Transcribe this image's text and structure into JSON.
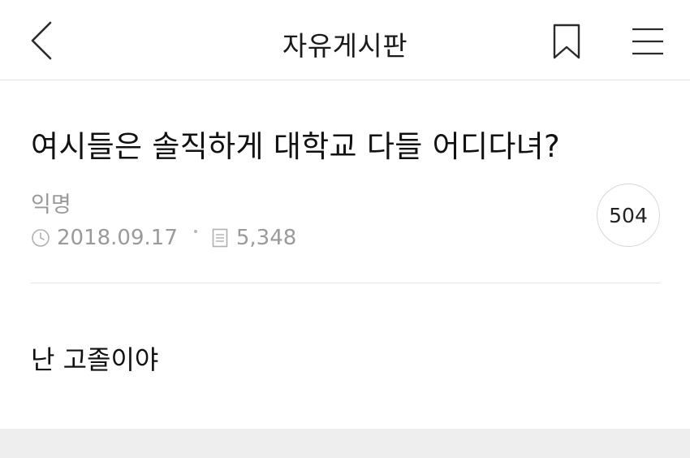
{
  "header": {
    "title": "자유게시판",
    "icons": {
      "back": "chevron-left-icon",
      "bookmark": "bookmark-icon",
      "menu": "hamburger-menu-icon"
    }
  },
  "post": {
    "title": "여시들은 솔직하게 대학교 다들 어디다녀?",
    "author": "익명",
    "date": "2018.09.17",
    "views": "5,348",
    "comments": "504",
    "body": "난 고졸이야"
  },
  "colors": {
    "text": "#111111",
    "meta": "#9a9a9a",
    "divider": "#e6e6e6",
    "bottom_band": "#eeeeef"
  }
}
